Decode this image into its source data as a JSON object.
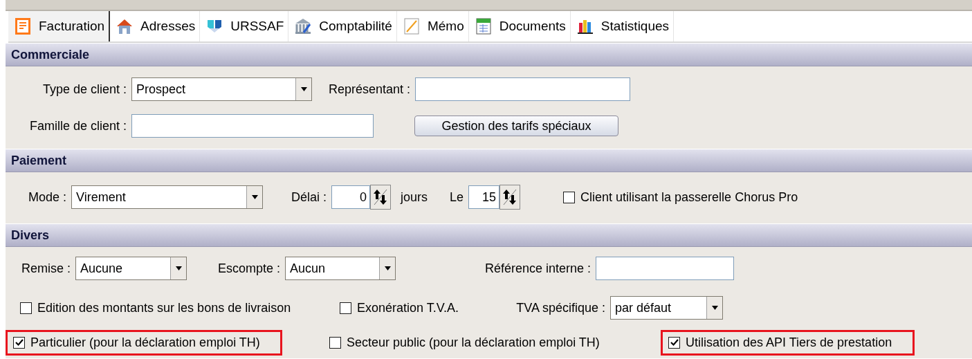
{
  "tabs": [
    {
      "label": "Facturation",
      "selected": true
    },
    {
      "label": "Adresses",
      "selected": false
    },
    {
      "label": "URSSAF",
      "selected": false
    },
    {
      "label": "Comptabilité",
      "selected": false
    },
    {
      "label": "Mémo",
      "selected": false
    },
    {
      "label": "Documents",
      "selected": false
    },
    {
      "label": "Statistiques",
      "selected": false
    }
  ],
  "sections": [
    {
      "title": "Commerciale",
      "rows": [
        [
          {
            "kind": "combo",
            "label": "Type de client :",
            "value": "Prospect"
          },
          {
            "kind": "field",
            "label": "Représentant :"
          }
        ],
        [
          {
            "kind": "field",
            "label": "Famille de client :"
          },
          {
            "kind": "button",
            "label": "Gestion des tarifs spéciaux"
          }
        ]
      ]
    },
    {
      "title": "Paiement",
      "rows": [
        [
          {
            "kind": "combo",
            "label": "Mode :",
            "value": "Virement"
          },
          {
            "kind": "spinner",
            "label": "Délai :",
            "value": "0",
            "suffix": "jours"
          },
          {
            "kind": "spinner",
            "label": "Le",
            "value": "15"
          },
          {
            "kind": "checkbox",
            "label": "Client utilisant la passerelle Chorus Pro",
            "checked": false
          }
        ]
      ]
    },
    {
      "title": "Divers",
      "rows": [
        [
          {
            "kind": "combo",
            "label": "Remise :",
            "value": "Aucune"
          },
          {
            "kind": "combo",
            "label": "Escompte :",
            "value": "Aucun"
          },
          {
            "kind": "field",
            "label": "Référence interne :"
          }
        ],
        [
          {
            "kind": "checkbox",
            "label": "Edition des montants sur les bons de livraison",
            "checked": false
          },
          {
            "kind": "checkbox",
            "label": "Exonération T.V.A.",
            "checked": false
          },
          {
            "kind": "combo",
            "label": "TVA spécifique :",
            "value": "par défaut"
          }
        ],
        [
          {
            "kind": "checkbox",
            "label": "Particulier (pour la déclaration emploi TH)",
            "checked": true,
            "highlighted": true
          },
          {
            "kind": "checkbox",
            "label": "Secteur public (pour la déclaration emploi TH)",
            "checked": false
          },
          {
            "kind": "checkbox",
            "label": "Utilisation des API Tiers de prestation",
            "checked": true,
            "highlighted": true
          }
        ]
      ]
    }
  ]
}
